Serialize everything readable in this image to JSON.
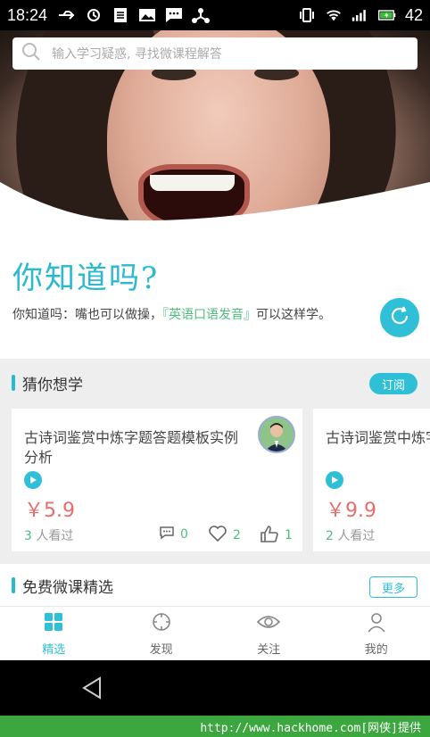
{
  "status_bar": {
    "time": "18:24",
    "battery": "42",
    "network": "4G"
  },
  "search": {
    "placeholder": "输入学习疑惑, 寻找微课程解答"
  },
  "did_you_know": {
    "title": "你知道吗?",
    "text_prefix": "你知道吗：嘴也可以做操，",
    "highlight": "『英语口语发音』",
    "text_suffix": "可以这样学。"
  },
  "guess": {
    "title": "猜你想学",
    "subscribe_label": "订阅",
    "cards": [
      {
        "title": "古诗词鉴赏中炼字题答题模板实例分析",
        "price": "￥5.9",
        "views_count": "3",
        "views_label": "人看过",
        "comments": "0",
        "likes": "2",
        "thumbs": "1"
      },
      {
        "title": "古诗词鉴赏中炼字题答题模板实例",
        "price": "￥9.9",
        "views_count": "2",
        "views_label": "人看过"
      }
    ]
  },
  "free": {
    "title": "免费微课精选",
    "more_label": "更多"
  },
  "tabs": [
    {
      "label": "精选",
      "icon": "grid-icon",
      "active": true
    },
    {
      "label": "发现",
      "icon": "compass-icon",
      "active": false
    },
    {
      "label": "关注",
      "icon": "eye-icon",
      "active": false
    },
    {
      "label": "我的",
      "icon": "person-icon",
      "active": false
    }
  ],
  "watermark": "http://www.hackhome.com[网侠]提供",
  "colors": {
    "accent": "#2fc0d8",
    "green": "#4cbf7a",
    "price": "#e66e6e",
    "watermark_bg": "#3ca73f"
  }
}
